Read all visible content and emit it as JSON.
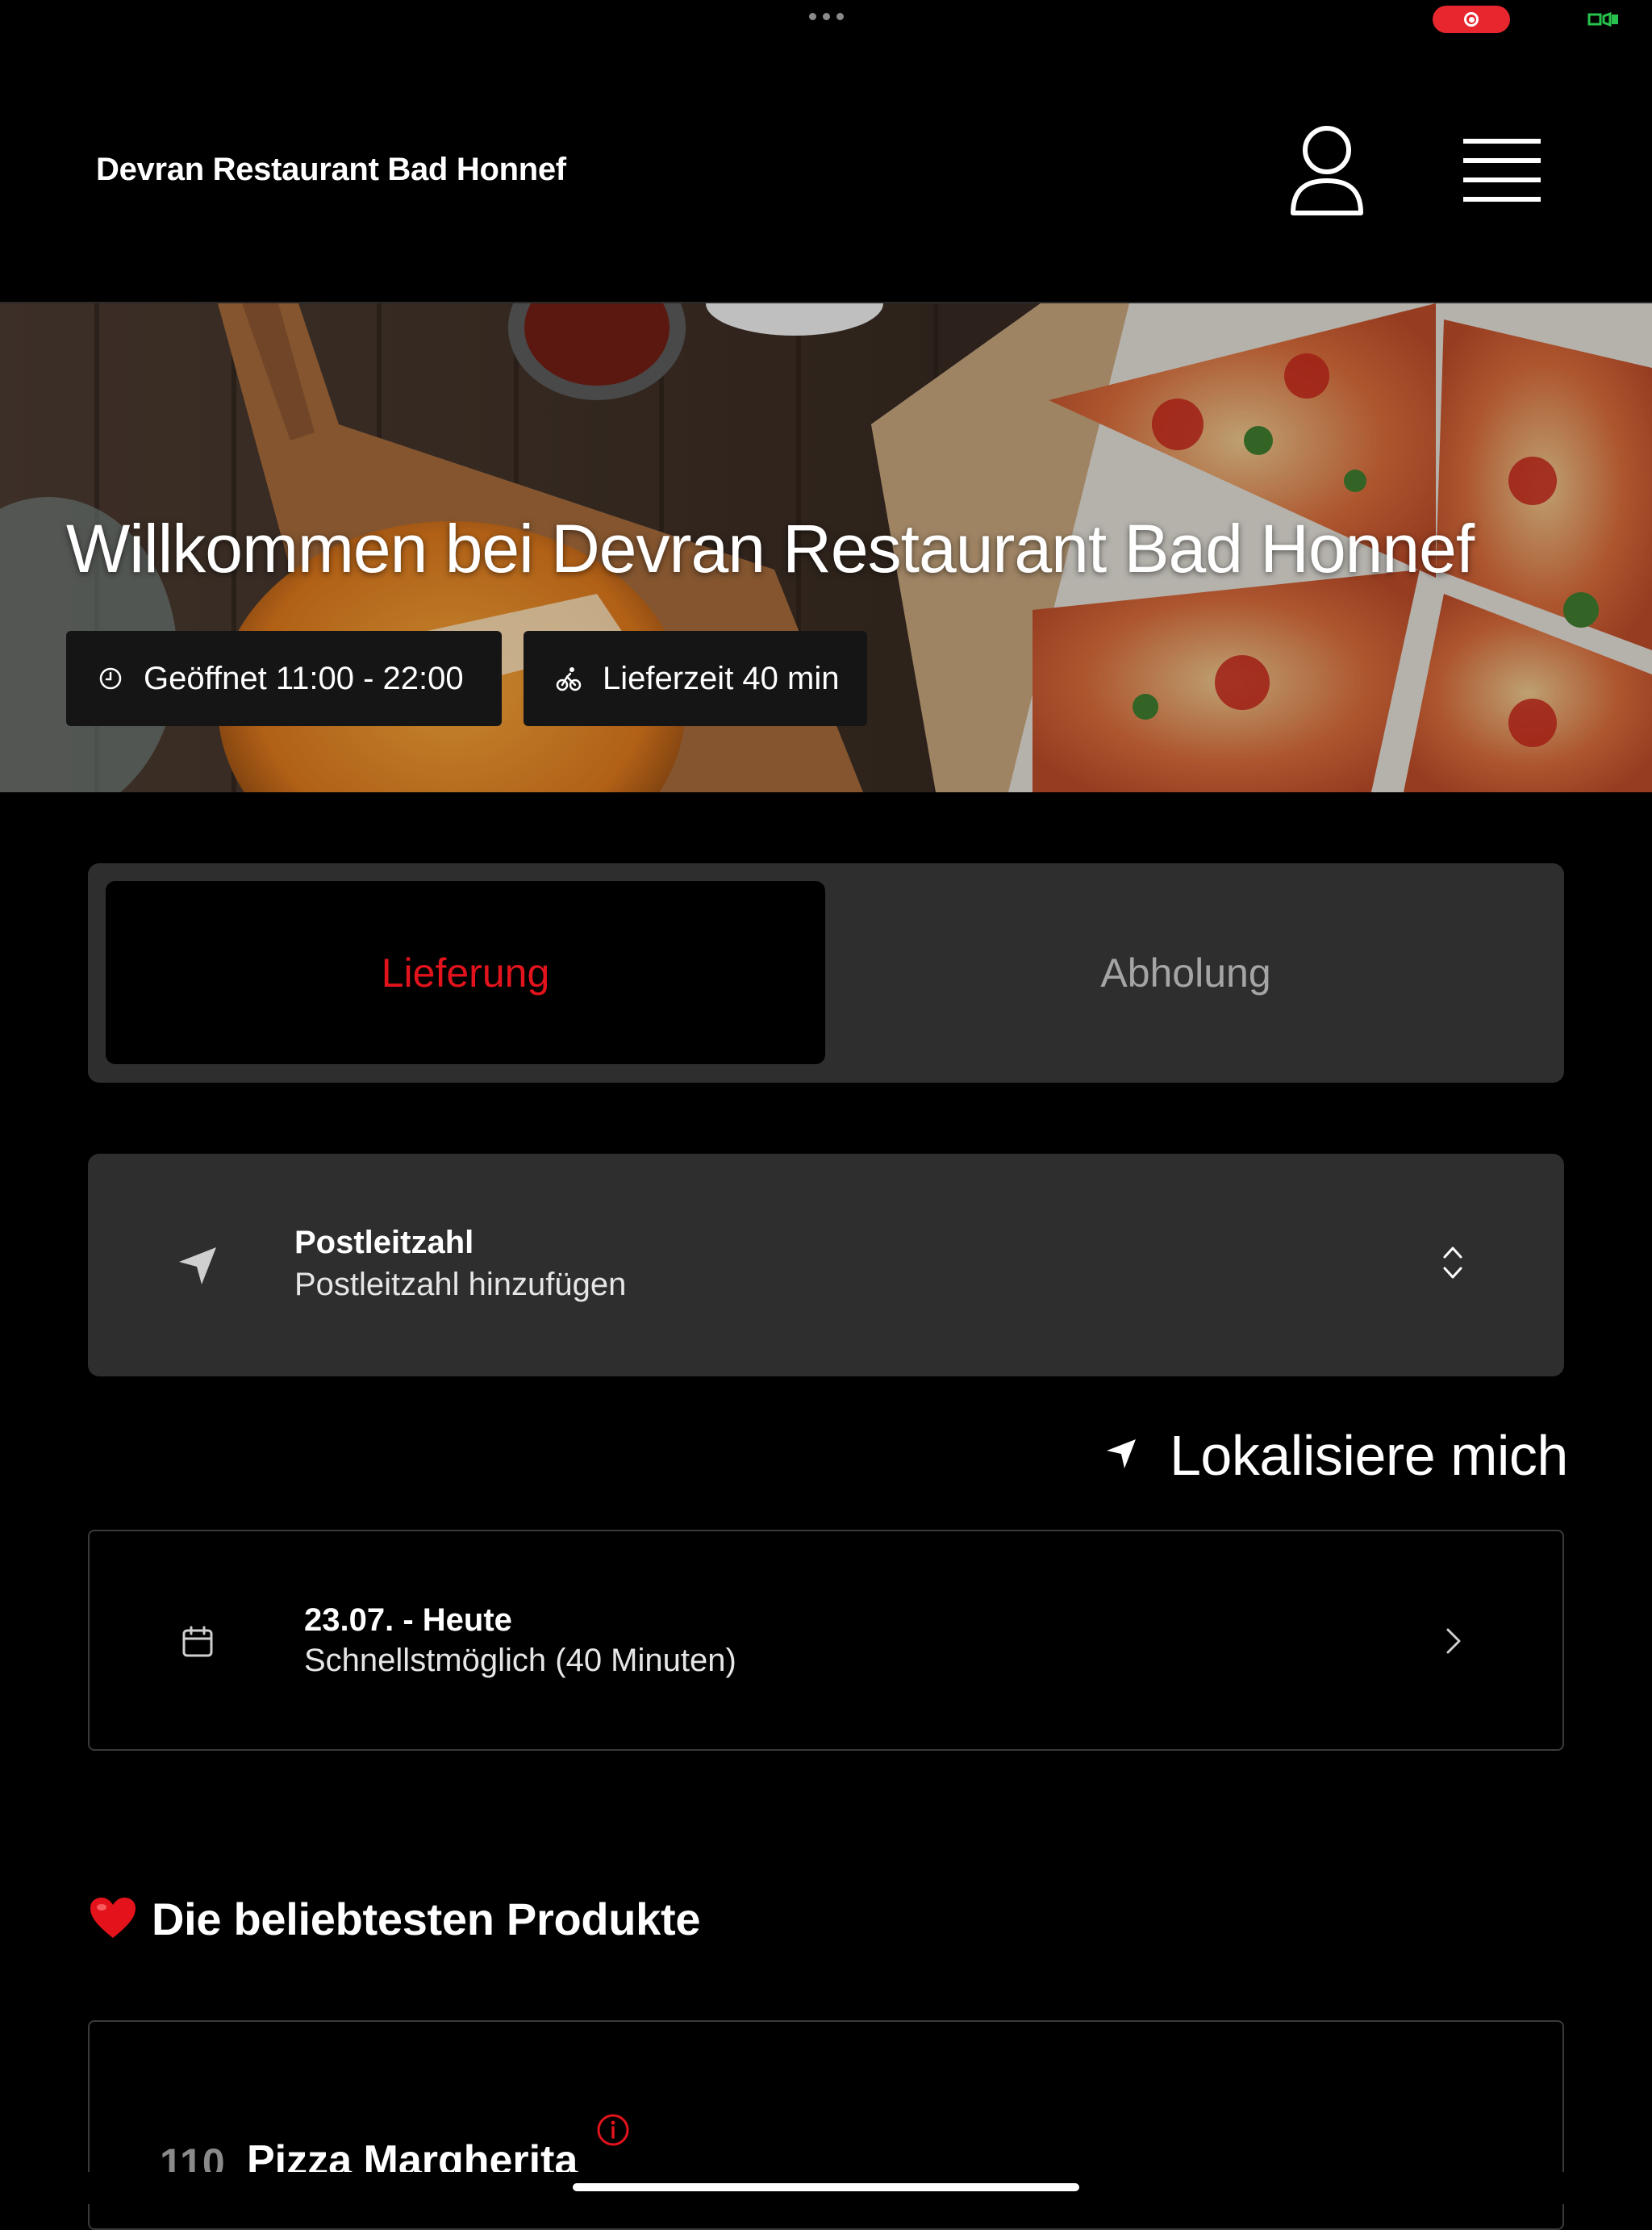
{
  "header": {
    "title": "Devran Restaurant Bad Honnef"
  },
  "hero": {
    "title": "Willkommen bei Devran Restaurant Bad Honnef",
    "opening_hours": "Geöffnet 11:00 - 22:00",
    "delivery_time": "Lieferzeit 40 min"
  },
  "order_type": {
    "tabs": [
      {
        "label": "Lieferung",
        "active": true
      },
      {
        "label": "Abholung",
        "active": false
      }
    ]
  },
  "postcode": {
    "label": "Postleitzahl",
    "value": "Postleitzahl hinzufügen"
  },
  "locate": {
    "label": "Lokalisiere mich"
  },
  "schedule": {
    "date": "23.07. - Heute",
    "time": "Schnellstmöglich (40 Minuten)"
  },
  "popular": {
    "title": "Die beliebtesten Produkte",
    "products": [
      {
        "number": "110",
        "name": "Pizza Margherita"
      }
    ]
  },
  "colors": {
    "background": "#000000",
    "accent": "#e3131c",
    "panel": "#2e2e2e",
    "chip": "#151515",
    "muted_text": "#a5a5a5"
  },
  "icons": {
    "header": [
      "user-icon",
      "menu-icon"
    ],
    "hero": [
      "clock-icon",
      "bike-icon"
    ],
    "postcode": [
      "navigation-arrow-icon",
      "chevron-up-down-icon"
    ],
    "locate": "navigation-arrow-icon",
    "schedule": [
      "calendar-icon",
      "chevron-right-icon"
    ],
    "popular": "heart-icon",
    "product": "info-icon"
  }
}
